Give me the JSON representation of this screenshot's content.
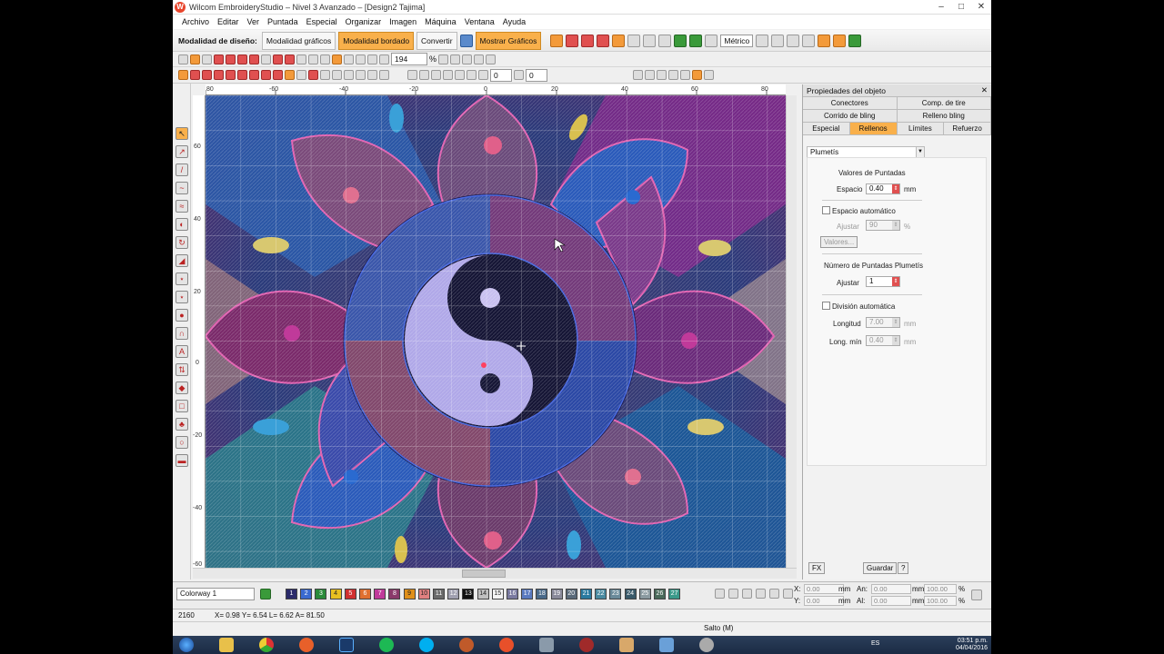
{
  "window": {
    "title": "Wilcom EmbroideryStudio – Nivel 3 Avanzado – [Design2    Tajima]"
  },
  "menu": [
    "Archivo",
    "Editar",
    "Ver",
    "Puntada",
    "Especial",
    "Organizar",
    "Imagen",
    "Máquina",
    "Ventana",
    "Ayuda"
  ],
  "toolbar": {
    "mode_label": "Modalidad de diseño:",
    "mode_graphics": "Modalidad gráficos",
    "mode_embroidery": "Modalidad bordado",
    "convert": "Convertir",
    "show_graphics": "Mostrar Gráficos",
    "units": "Métrico",
    "zoom": "194",
    "zoom_unit": "%",
    "field_a": "0",
    "field_b": "0"
  },
  "ruler_top": [
    "80",
    "-60",
    "-40",
    "-20",
    "0",
    "20",
    "40",
    "60",
    "80"
  ],
  "ruler_left": [
    "60",
    "40",
    "20",
    "0",
    "-20",
    "-40",
    "-60"
  ],
  "properties": {
    "title": "Propiedades del objeto",
    "tabs_row1": [
      "Conectores",
      "Comp. de tire"
    ],
    "tabs_row2": [
      "Corrido de bling",
      "Relleno bling"
    ],
    "tabs_row3": [
      "Especial",
      "Rellenos",
      "Límites",
      "Refuerzo"
    ],
    "fill_type": "Plumetís",
    "stitch_values_title": "Valores de Puntadas",
    "spacing_label": "Espacio",
    "spacing_value": "0.40",
    "spacing_unit": "mm",
    "auto_spacing": "Espacio automático",
    "adjust_label": "Ajustar",
    "adjust_value": "90",
    "adjust_unit": "%",
    "values_button": "Valores...",
    "plumetis_count_title": "Número de Puntadas Plumetís",
    "adjust2_label": "Ajustar",
    "adjust2_value": "1",
    "auto_split": "División automática",
    "length_label": "Longitud",
    "length_value": "7.00",
    "length_unit": "mm",
    "minlen_label": "Long. mín",
    "minlen_value": "0.40",
    "minlen_unit": "mm",
    "fx_button": "FX",
    "save_button": "Guardar",
    "help_button": "?"
  },
  "colorway": {
    "name": "Colorway 1",
    "chips": [
      {
        "n": "1",
        "c": "#2a2a6a"
      },
      {
        "n": "2",
        "c": "#3a6ad0"
      },
      {
        "n": "3",
        "c": "#2a8a3a"
      },
      {
        "n": "4",
        "c": "#e8c020"
      },
      {
        "n": "5",
        "c": "#d03030"
      },
      {
        "n": "6",
        "c": "#e07030"
      },
      {
        "n": "7",
        "c": "#c03a9a"
      },
      {
        "n": "8",
        "c": "#8a3a6a"
      },
      {
        "n": "9",
        "c": "#e0901a"
      },
      {
        "n": "10",
        "c": "#e08080"
      },
      {
        "n": "11",
        "c": "#6a6a6a"
      },
      {
        "n": "12",
        "c": "#a0a0b0"
      },
      {
        "n": "13",
        "c": "#101010"
      },
      {
        "n": "14",
        "c": "#c0c0c0"
      },
      {
        "n": "15",
        "c": "#f4f4f4"
      },
      {
        "n": "16",
        "c": "#7a7aa0"
      },
      {
        "n": "17",
        "c": "#5a7ac0"
      },
      {
        "n": "18",
        "c": "#4a6a8a"
      },
      {
        "n": "19",
        "c": "#8a8a9a"
      },
      {
        "n": "20",
        "c": "#5a6a7a"
      },
      {
        "n": "21",
        "c": "#2a7aa0"
      },
      {
        "n": "22",
        "c": "#4a8aa0"
      },
      {
        "n": "23",
        "c": "#6a8a9a"
      },
      {
        "n": "24",
        "c": "#3a5a6a"
      },
      {
        "n": "25",
        "c": "#8a9aa0"
      },
      {
        "n": "26",
        "c": "#4a6a5a"
      },
      {
        "n": "27",
        "c": "#3a9a8a"
      }
    ]
  },
  "coords": {
    "x_label": "X:",
    "x_value": "0.00",
    "y_label": "Y:",
    "y_value": "0.00",
    "w_label": "An:",
    "w_value": "0.00",
    "h_label": "Al:",
    "h_value": "0.00",
    "unit": "mm",
    "pw_value": "100.00",
    "ph_value": "100.00",
    "pct": "%"
  },
  "status": {
    "stitches": "2160",
    "readout": "X=  0.98 Y=  6.54 L=  6.62 A= 81.50",
    "right": "Salto (M)"
  },
  "tray": {
    "lang": "ES",
    "time": "03:51 p.m.",
    "date": "04/04/2016"
  }
}
